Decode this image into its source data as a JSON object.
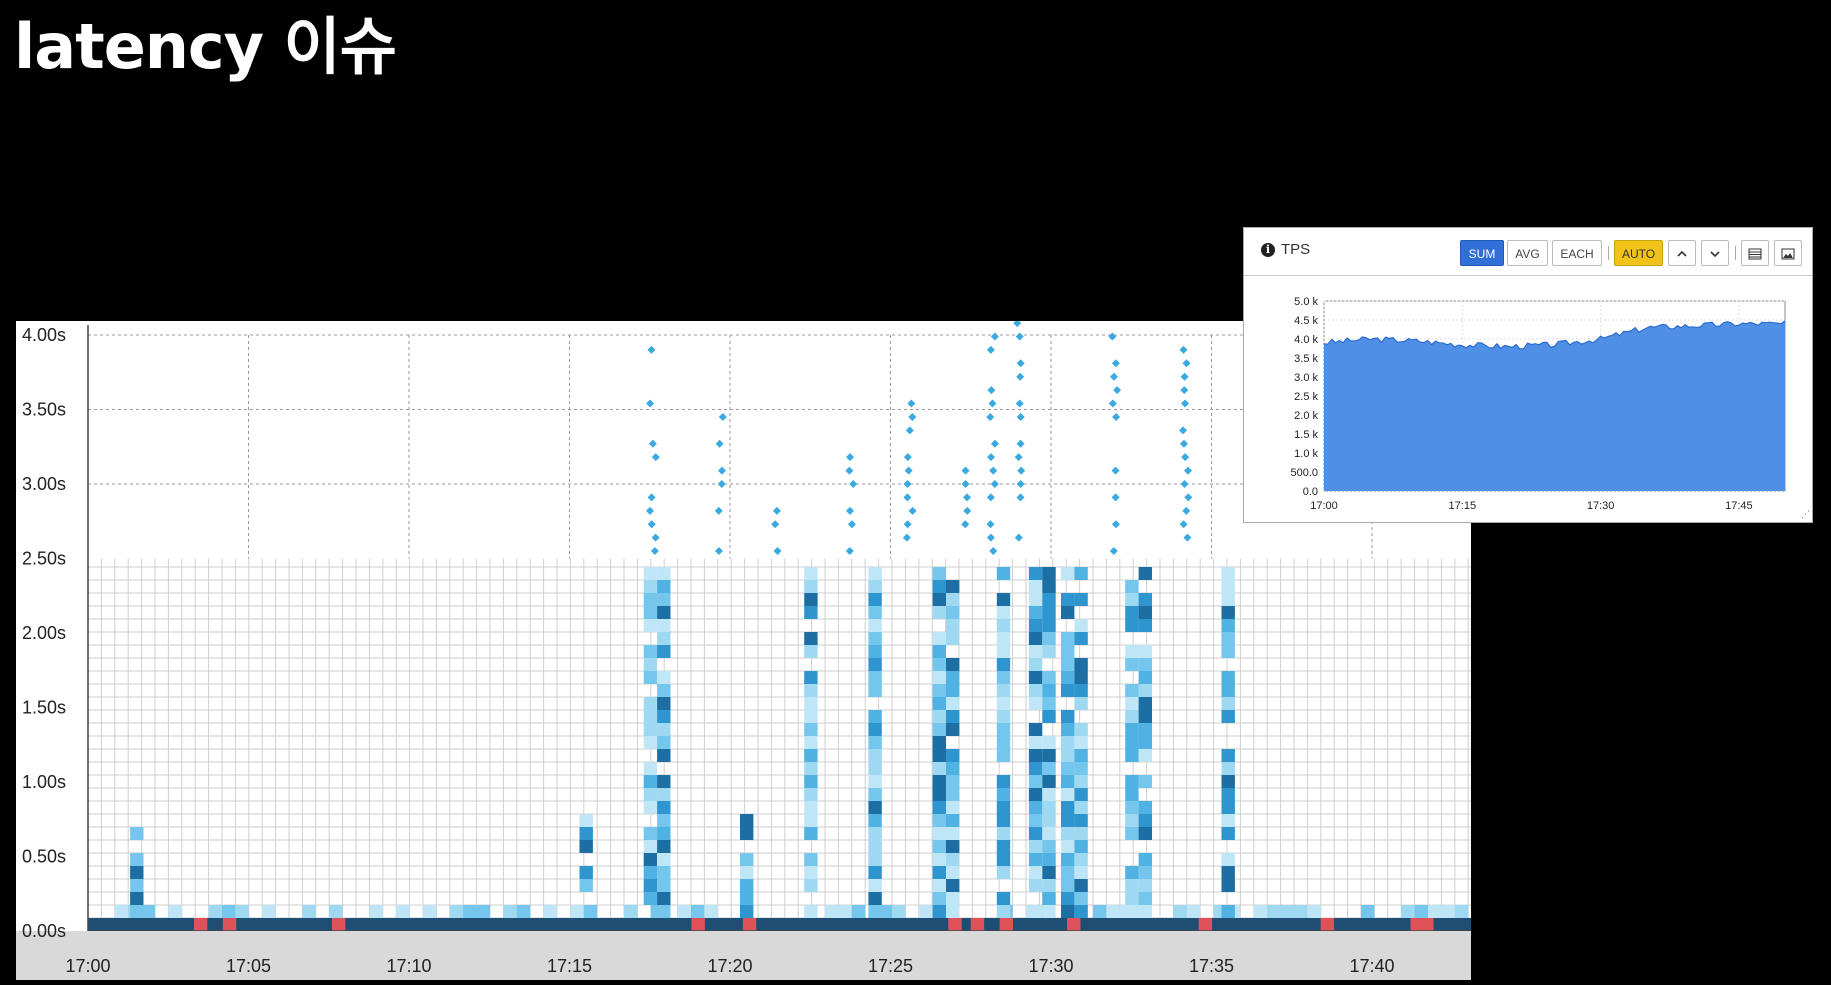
{
  "slide": {
    "title": "latency 이슈"
  },
  "heatmap": {
    "y_tick_labels": [
      "0.00s",
      "0.50s",
      "1.00s",
      "1.50s",
      "2.00s",
      "2.50s",
      "3.00s",
      "3.50s",
      "4.00s"
    ],
    "x_tick_labels": [
      "17:00",
      "17:05",
      "17:10",
      "17:15",
      "17:20",
      "17:25",
      "17:30",
      "17:35",
      "17:40"
    ],
    "colors": {
      "error_red": "#e0525a",
      "base_band": "#1e4e73",
      "grid": "#cfcfcf",
      "dot": "#3aa9e0"
    }
  },
  "tps_panel": {
    "title": "TPS",
    "info_icon": "info-icon",
    "buttons": {
      "sum": "SUM",
      "avg": "AVG",
      "each": "EACH",
      "auto": "AUTO"
    },
    "icons": [
      "chevron-up-icon",
      "chevron-down-icon",
      "table-icon",
      "image-icon"
    ],
    "colors": {
      "sum_active": "#2f6fd6",
      "auto_active": "#f1c319",
      "area_fill": "#4f8fe6",
      "area_line": "#2c6bd0"
    }
  },
  "chart_data": [
    {
      "type": "heatmap",
      "title": "",
      "xlabel": "",
      "ylabel": "",
      "x_range": [
        "17:00",
        "17:43"
      ],
      "y_range_seconds": [
        0,
        4.0
      ],
      "grid": true,
      "spike_times": [
        "17:01",
        "17:15",
        "17:17",
        "17:20",
        "17:22",
        "17:24",
        "17:26",
        "17:28",
        "17:29",
        "17:30",
        "17:32",
        "17:35"
      ],
      "x_ticks": [
        "17:00",
        "17:05",
        "17:10",
        "17:15",
        "17:20",
        "17:25",
        "17:30",
        "17:35",
        "17:40"
      ],
      "y_ticks": [
        "0.00s",
        "0.50s",
        "1.00s",
        "1.50s",
        "2.00s",
        "2.50s",
        "3.00s",
        "3.50s",
        "4.00s"
      ]
    },
    {
      "type": "area",
      "title": "TPS",
      "series": [
        {
          "name": "TPS",
          "x": [
            "17:00",
            "17:05",
            "17:10",
            "17:15",
            "17:20",
            "17:25",
            "17:30",
            "17:35",
            "17:40",
            "17:45",
            "17:50"
          ],
          "values": [
            3900,
            4000,
            3950,
            3850,
            3800,
            3850,
            4000,
            4300,
            4350,
            4400,
            4400
          ]
        }
      ],
      "x_ticks": [
        "17:00",
        "17:15",
        "17:30",
        "17:45"
      ],
      "y_ticks": [
        "0.0",
        "500.0",
        "1.0 k",
        "1.5 k",
        "2.0 k",
        "2.5 k",
        "3.0 k",
        "3.5 k",
        "4.0 k",
        "4.5 k",
        "5.0 k"
      ],
      "ylim": [
        0,
        5000
      ],
      "grid": true
    }
  ]
}
